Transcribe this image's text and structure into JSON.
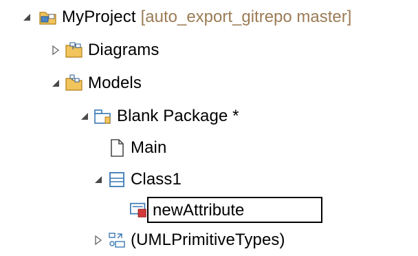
{
  "tree": {
    "project": {
      "label": "MyProject",
      "decoration": "[auto_export_gitrepo master]"
    },
    "diagrams": {
      "label": "Diagrams"
    },
    "models": {
      "label": "Models"
    },
    "blank_package": {
      "label": "Blank Package *"
    },
    "main": {
      "label": "Main"
    },
    "class1": {
      "label": "Class1"
    },
    "new_attribute": {
      "value": "newAttribute"
    },
    "primitive_types": {
      "label": "(UMLPrimitiveTypes)"
    }
  },
  "colors": {
    "decoration": "#9b7b55",
    "folder": "#e8b54a",
    "package": "#3a78b4"
  }
}
